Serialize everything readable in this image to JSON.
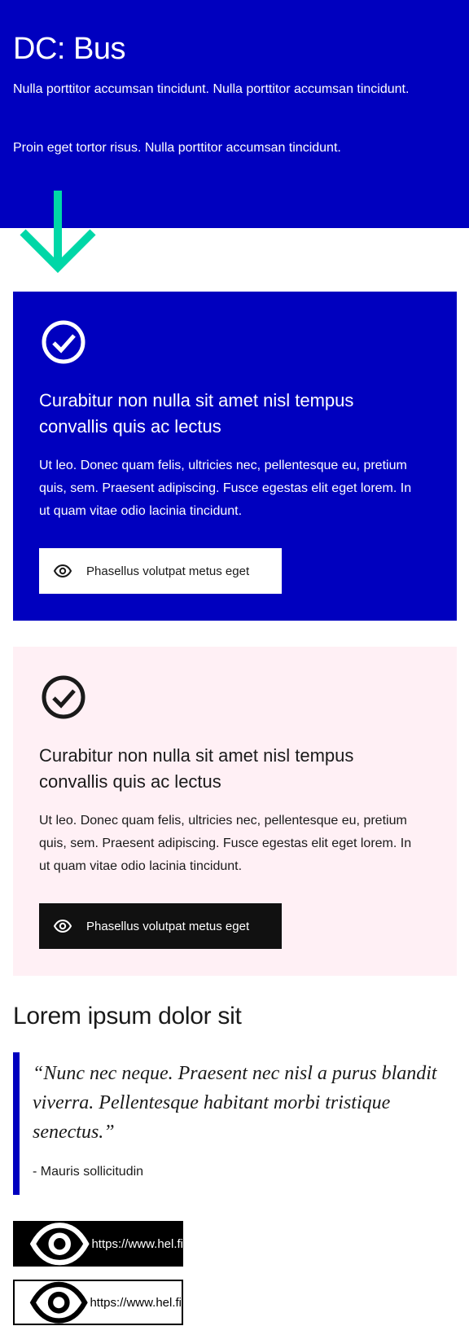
{
  "hero": {
    "title": "DC: Bus",
    "paragraph_1": "Nulla porttitor accumsan tincidunt. Nulla porttitor accumsan tincidunt.",
    "paragraph_2": "Proin eget tortor risus. Nulla porttitor accumsan tincidunt.",
    "background_color": "#0000bf",
    "arrow_color": "#00d7a7",
    "arrow_icon": "arrow-down-icon"
  },
  "cards": [
    {
      "theme": "blue",
      "icon": "check-circle-icon",
      "title": "Curabitur non nulla sit amet nisl tempus convallis quis ac lectus",
      "body": "Ut leo. Donec quam felis, ultricies nec, pellentesque eu, pretium quis, sem. Praesent adipiscing. Fusce egestas elit eget lorem. In ut quam vitae odio lacinia tincidunt.",
      "button_label": "Phasellus volutpat metus eget",
      "button_icon": "eye-icon",
      "background_color": "#0000bf"
    },
    {
      "theme": "pink",
      "icon": "check-circle-icon",
      "title": "Curabitur non nulla sit amet nisl tempus convallis quis ac lectus",
      "body": "Ut leo. Donec quam felis, ultricies nec, pellentesque eu, pretium quis, sem. Praesent adipiscing. Fusce egestas elit eget lorem. In ut quam vitae odio lacinia tincidunt.",
      "button_label": "Phasellus volutpat metus eget",
      "button_icon": "eye-icon",
      "background_color": "#fff0f5"
    }
  ],
  "section": {
    "heading": "Lorem ipsum dolor sit",
    "quote": "“Nunc nec neque. Praesent nec nisl a purus blandit viverra. Pellentesque habitant morbi tristique senectus.”",
    "author": "- Mauris sollicitudin",
    "quote_bar_color": "#0000bf"
  },
  "links": [
    {
      "label": "https://www.hel.fi",
      "style": "filled",
      "icon": "eye-icon"
    },
    {
      "label": "https://www.hel.fi",
      "style": "outline",
      "icon": "eye-icon"
    }
  ]
}
